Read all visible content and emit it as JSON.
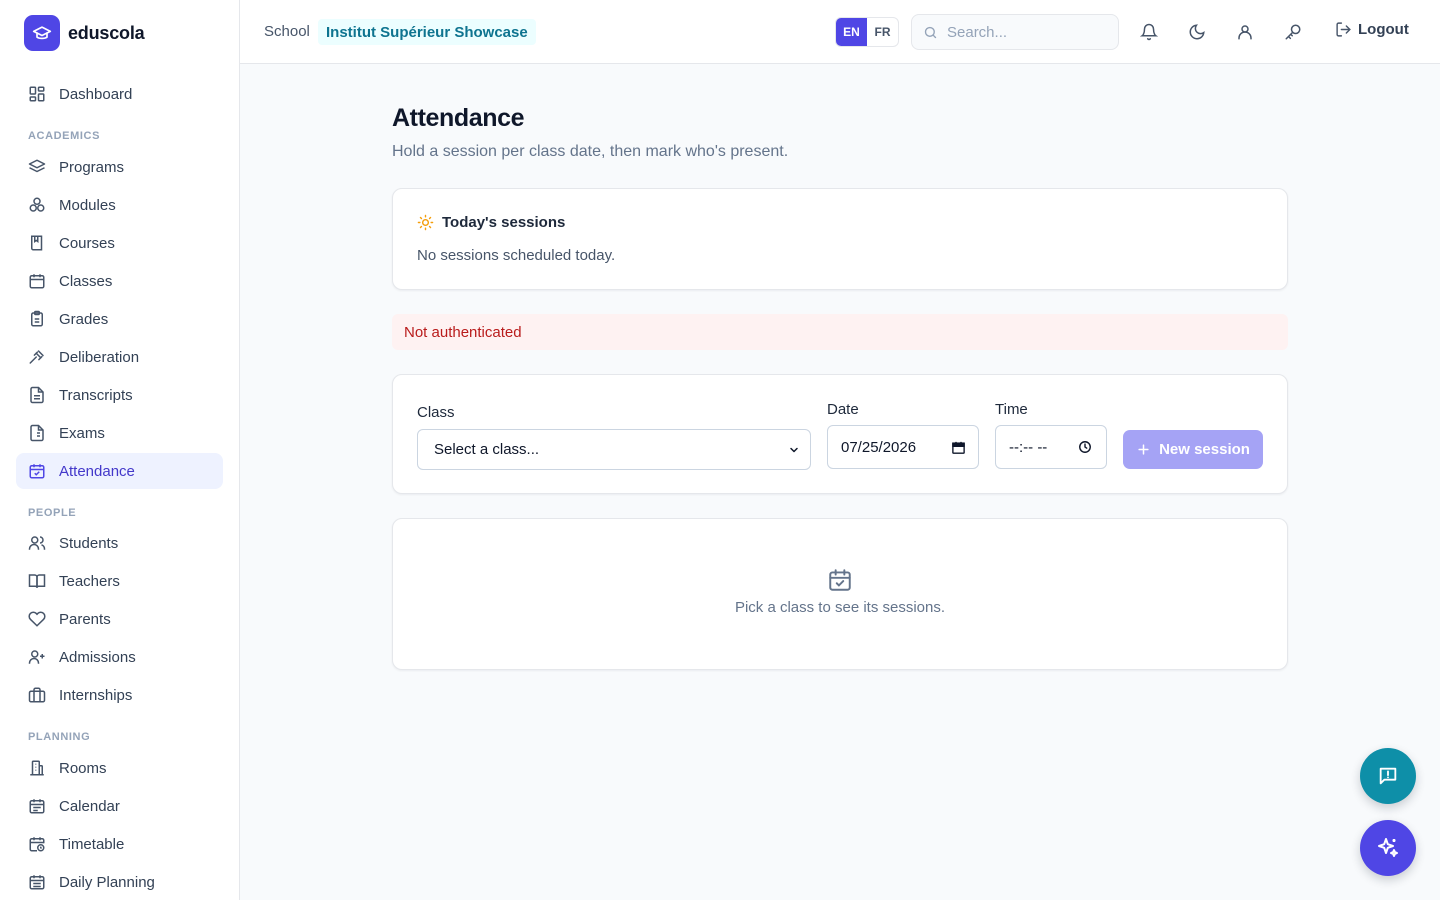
{
  "app": {
    "name": "eduscola"
  },
  "sidebar": {
    "dashboard": {
      "label": "Dashboard",
      "icon": "dashboard-grid-icon"
    },
    "sections": [
      {
        "title": "ACADEMICS",
        "items": [
          {
            "label": "Programs",
            "icon": "layers-icon"
          },
          {
            "label": "Modules",
            "icon": "modules-icon"
          },
          {
            "label": "Courses",
            "icon": "book-icon"
          },
          {
            "label": "Classes",
            "icon": "calendar-grid-icon"
          },
          {
            "label": "Grades",
            "icon": "clipboard-icon"
          },
          {
            "label": "Deliberation",
            "icon": "gavel-icon"
          },
          {
            "label": "Transcripts",
            "icon": "document-icon"
          },
          {
            "label": "Exams",
            "icon": "exam-sheet-icon"
          },
          {
            "label": "Attendance",
            "icon": "calendar-check-icon",
            "active": true
          }
        ]
      },
      {
        "title": "PEOPLE",
        "items": [
          {
            "label": "Students",
            "icon": "users-icon"
          },
          {
            "label": "Teachers",
            "icon": "open-book-icon"
          },
          {
            "label": "Parents",
            "icon": "heart-icon"
          },
          {
            "label": "Admissions",
            "icon": "user-plus-icon"
          },
          {
            "label": "Internships",
            "icon": "briefcase-icon"
          }
        ]
      },
      {
        "title": "PLANNING",
        "items": [
          {
            "label": "Rooms",
            "icon": "building-icon"
          },
          {
            "label": "Calendar",
            "icon": "calendar-icon"
          },
          {
            "label": "Timetable",
            "icon": "calendar-clock-icon"
          },
          {
            "label": "Daily Planning",
            "icon": "calendar-list-icon"
          }
        ]
      }
    ]
  },
  "topbar": {
    "school_label": "School",
    "school_name": "Institut Supérieur Showcase",
    "languages": [
      "EN",
      "FR"
    ],
    "active_language": "EN",
    "search_placeholder": "Search...",
    "logout_label": "Logout"
  },
  "page": {
    "title": "Attendance",
    "subtitle": "Hold a session per class date, then mark who's present."
  },
  "today_card": {
    "title": "Today's sessions",
    "empty_text": "No sessions scheduled today."
  },
  "alert": {
    "text": "Not authenticated"
  },
  "session_form": {
    "class_label": "Class",
    "class_placeholder": "Select a class...",
    "date_label": "Date",
    "date_value": "07/25/2026",
    "time_label": "Time",
    "time_value": "--:-- --",
    "new_session_label": "New session"
  },
  "empty_state": {
    "text": "Pick a class to see its sessions."
  },
  "colors": {
    "accent": "#4f46e5",
    "accent_soft": "#eef2ff",
    "school_badge_bg": "#ecfeff",
    "school_badge_text": "#0e7490",
    "alert_bg": "#fef2f2",
    "alert_text": "#b91c1c",
    "fab_teal": "#0e8fa8",
    "fab_indigo": "#4f46e5",
    "button_disabled": "#a5a3f5"
  }
}
